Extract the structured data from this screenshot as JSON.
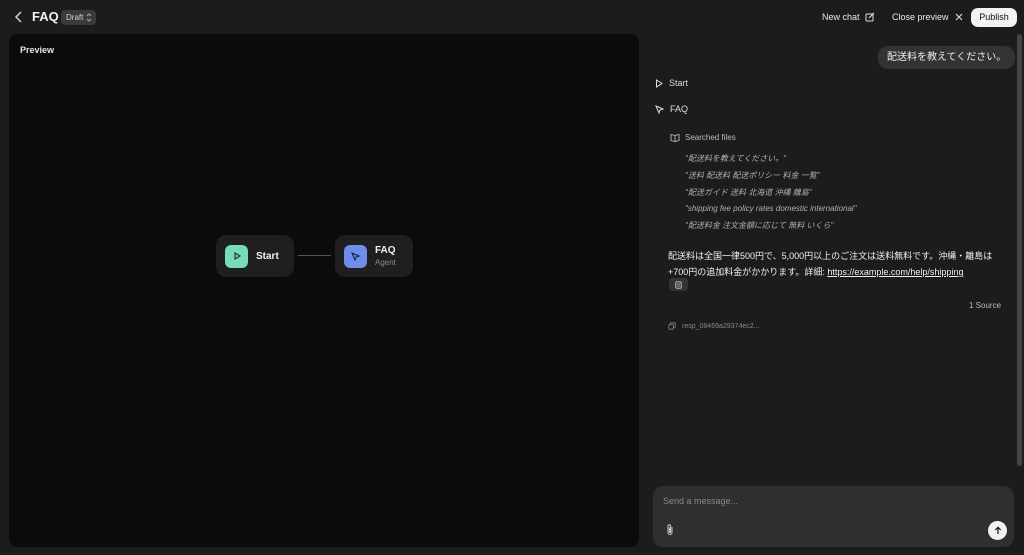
{
  "header": {
    "title": "FAQ",
    "draft_label": "Draft",
    "new_chat_label": "New chat",
    "close_preview_label": "Close preview",
    "publish_label": "Publish"
  },
  "preview": {
    "label": "Preview",
    "nodes": [
      {
        "label": "Start",
        "sublabel": "",
        "icon": "play-icon",
        "color": "#76dbb6"
      },
      {
        "label": "FAQ",
        "sublabel": "Agent",
        "icon": "cursor-icon",
        "color": "#6f8dea"
      }
    ]
  },
  "chat": {
    "user_message": "配送料を教えてください。",
    "steps": [
      {
        "label": "Start",
        "icon": "play-icon"
      },
      {
        "label": "FAQ",
        "icon": "cursor-icon"
      }
    ],
    "searched_files_label": "Searched files",
    "queries": [
      "\"配送料を教えてください。\"",
      "\"送料 配送料 配送ポリシー 料金 一覧\"",
      "\"配送ガイド 送料 北海道 沖縄 離島\"",
      "\"shipping fee policy rates domestic international\"",
      "\"配送料金 注文金額に応じて 無料 いくら\""
    ],
    "answer_text": "配送料は全国一律500円で、5,000円以上のご注文は送料無料です。沖縄・離島は+700円の追加料金がかかります。詳細: ",
    "answer_link": "https://example.com/help/shipping",
    "sources_label": "1 Source",
    "response_id": "resp_08469a29374ec2..."
  },
  "composer": {
    "placeholder": "Send a message..."
  }
}
